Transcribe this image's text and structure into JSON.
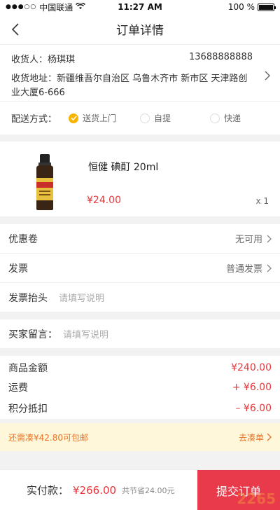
{
  "status_bar": {
    "carrier": "中国联通",
    "time": "11:27 AM",
    "battery": "100 %",
    "battery_level": 1.0
  },
  "nav": {
    "title": "订单详情",
    "back_icon": "chevron-left-icon"
  },
  "address": {
    "receiver_label": "收货人：",
    "receiver_name": "杨琪琪",
    "phone": "13688888888",
    "address_label": "收货地址：",
    "address_text": "新疆维吾尔自治区  乌鲁木齐市  新市区  天津路创业大厦6-666"
  },
  "delivery": {
    "label": "配送方式：",
    "options": [
      {
        "label": "送货上门",
        "selected": true
      },
      {
        "label": "自提",
        "selected": false
      },
      {
        "label": "快递",
        "selected": false
      }
    ]
  },
  "product": {
    "name": "恒健 碘酊 20ml",
    "price": "¥24.00",
    "qty": "x 1"
  },
  "rows": {
    "coupon": {
      "label": "优惠卷",
      "value": "无可用"
    },
    "invoice": {
      "label": "发票",
      "value": "普通发票"
    },
    "invoice_title": {
      "label": "发票抬头",
      "placeholder": "请填写说明"
    },
    "message": {
      "label": "买家留言：",
      "placeholder": "请填写说明"
    }
  },
  "summary": {
    "goods_label": "商品金额",
    "goods_amount": "¥240.00",
    "shipping_label": "运费",
    "shipping_amount": "+ ¥6.00",
    "points_label": "积分抵扣",
    "points_amount": "– ¥6.00"
  },
  "notice": {
    "text": "还需凑¥42.80可包邮",
    "link": "去凑单"
  },
  "bottom": {
    "pay_label": "实付款：",
    "total": "¥266.00",
    "saved": "共节省24.00元",
    "submit": "提交订单"
  },
  "watermark": "2265",
  "colors": {
    "accent_red": "#e8363a",
    "radio_yellow": "#f7b500",
    "notice_bg": "#fff7d9",
    "notice_text": "#e8742a",
    "submit_bg": "#e83a4a"
  }
}
